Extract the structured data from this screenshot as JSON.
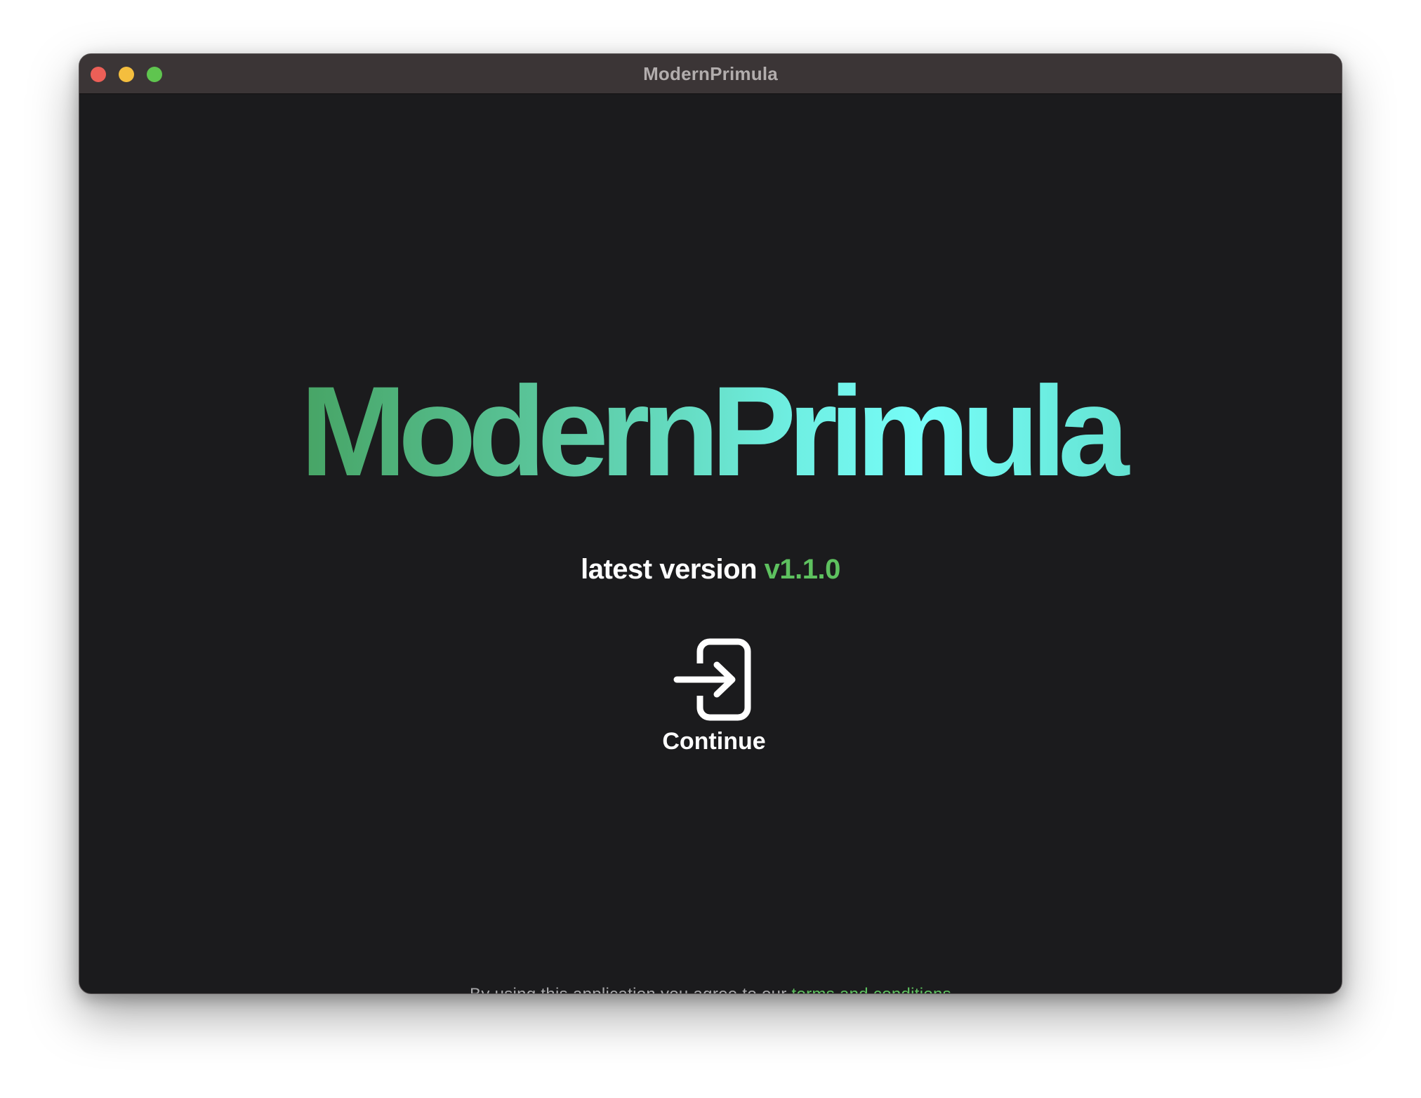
{
  "window": {
    "title": "ModernPrimula"
  },
  "main": {
    "logo_text": "ModernPrimula",
    "version_label": "latest version",
    "version_number": "v1.1.0",
    "continue_label": "Continue",
    "continue_icon": "login-arrow-icon"
  },
  "footer": {
    "text": "By using this application you agree to our",
    "link_text": "terms and conditions"
  },
  "colors": {
    "background": "#1b1b1d",
    "titlebar": "#3b3536",
    "accent_green": "#5ec15f",
    "gradient_start": "#45a160",
    "gradient_end": "#76fdf8"
  }
}
